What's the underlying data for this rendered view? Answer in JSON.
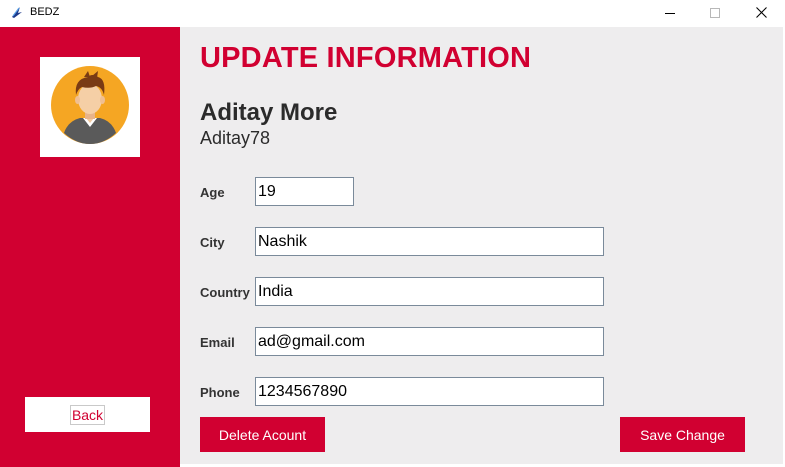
{
  "window": {
    "title": "BEDZ",
    "icon": "app-feather-icon",
    "controls": [
      "minimize-icon",
      "maximize-icon",
      "close-icon"
    ]
  },
  "sidebar": {
    "avatar_icon": "user-avatar-icon",
    "back_label": "Back",
    "color": "#d10031"
  },
  "main": {
    "title": "UPDATE INFORMATION",
    "user_name": "Aditay More",
    "username": "Aditay78",
    "fields": {
      "age": {
        "label": "Age",
        "value": "19"
      },
      "city": {
        "label": "City",
        "value": "Nashik"
      },
      "country": {
        "label": "Country",
        "value": "India"
      },
      "email": {
        "label": "Email",
        "value": "ad@gmail.com"
      },
      "phone": {
        "label": "Phone",
        "value": "1234567890"
      }
    },
    "delete_label": "Delete Acount",
    "save_label": "Save Change"
  },
  "colors": {
    "accent": "#d10031",
    "panel": "#eeedee",
    "text": "#2b2b2b"
  }
}
